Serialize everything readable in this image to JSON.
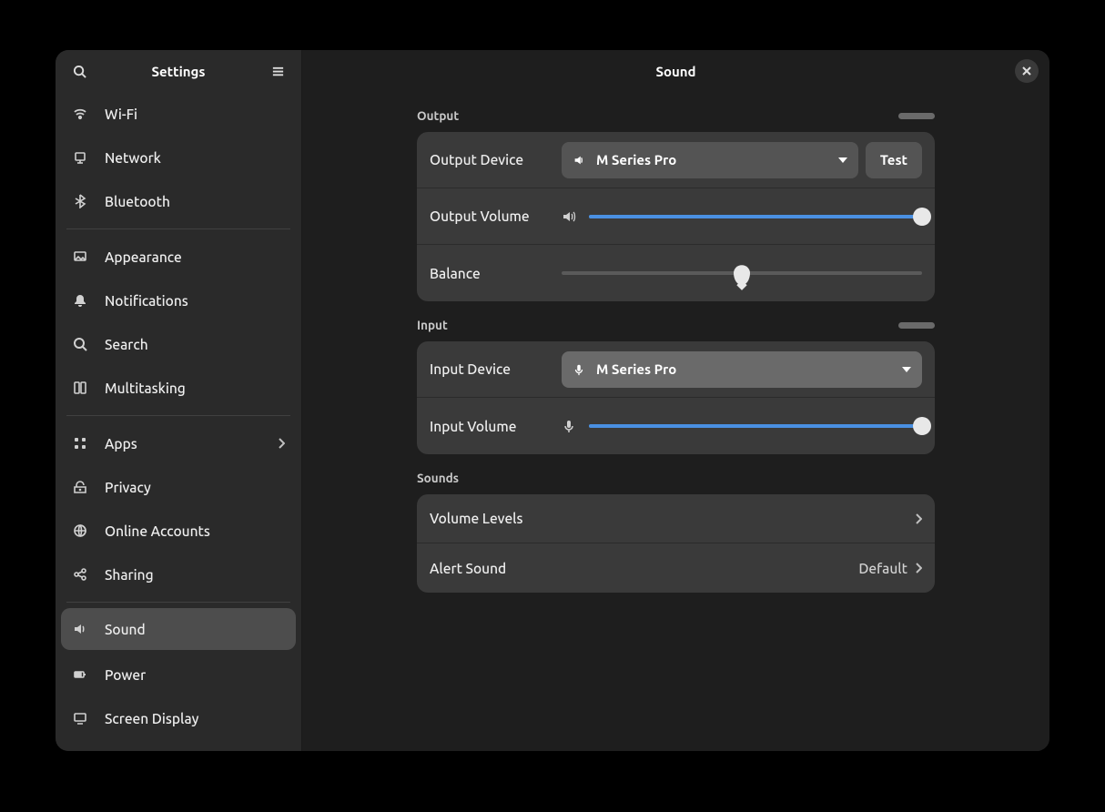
{
  "sidebar": {
    "title": "Settings",
    "items": [
      {
        "label": "Wi-Fi",
        "icon": "wifi"
      },
      {
        "label": "Network",
        "icon": "network"
      },
      {
        "label": "Bluetooth",
        "icon": "bluetooth"
      },
      {
        "sep": true
      },
      {
        "label": "Appearance",
        "icon": "appearance"
      },
      {
        "label": "Notifications",
        "icon": "bell"
      },
      {
        "label": "Search",
        "icon": "search"
      },
      {
        "label": "Multitasking",
        "icon": "multitasking"
      },
      {
        "sep": true
      },
      {
        "label": "Apps",
        "icon": "apps",
        "chevron": true
      },
      {
        "label": "Privacy",
        "icon": "privacy"
      },
      {
        "label": "Online Accounts",
        "icon": "online-accounts"
      },
      {
        "label": "Sharing",
        "icon": "sharing"
      },
      {
        "sep": true
      },
      {
        "label": "Sound",
        "icon": "sound",
        "selected": true
      },
      {
        "label": "Power",
        "icon": "power"
      },
      {
        "label": "Screen Display",
        "icon": "display"
      }
    ]
  },
  "main": {
    "title": "Sound",
    "output": {
      "heading": "Output",
      "device_label": "Output Device",
      "device_value": "M Series Pro",
      "test_label": "Test",
      "volume_label": "Output Volume",
      "volume_percent": 100,
      "balance_label": "Balance",
      "balance_percent": 50
    },
    "input": {
      "heading": "Input",
      "device_label": "Input Device",
      "device_value": "M Series Pro",
      "volume_label": "Input Volume",
      "volume_percent": 100
    },
    "sounds": {
      "heading": "Sounds",
      "volume_levels_label": "Volume Levels",
      "alert_label": "Alert Sound",
      "alert_value": "Default"
    }
  }
}
